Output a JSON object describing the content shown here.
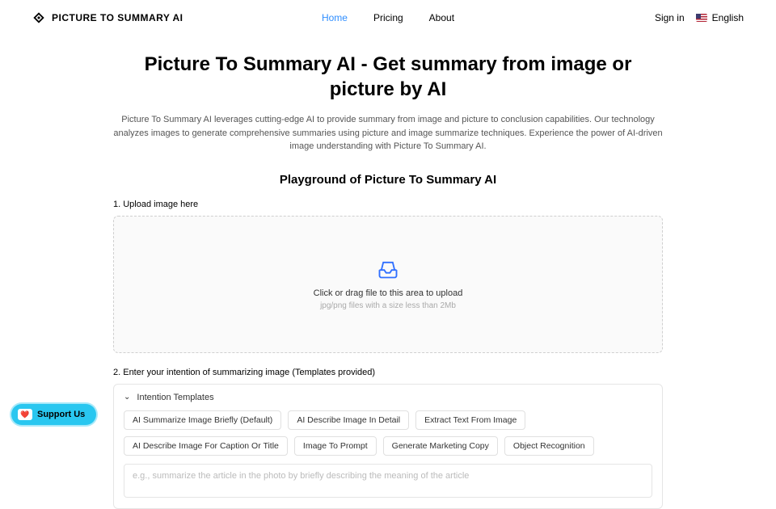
{
  "brand": "PICTURE TO SUMMARY AI",
  "nav": {
    "home": "Home",
    "pricing": "Pricing",
    "about": "About"
  },
  "header": {
    "signin": "Sign in",
    "lang": "English"
  },
  "hero": {
    "title": "Picture To Summary AI - Get summary from image or picture by AI",
    "desc": "Picture To Summary AI leverages cutting-edge AI to provide summary from image and picture to conclusion capabilities. Our technology analyzes images to generate comprehensive summaries using picture and image summarize techniques. Experience the power of AI-driven image understanding with Picture To Summary AI."
  },
  "playground": {
    "title": "Playground of Picture To Summary AI",
    "step1": "1. Upload image here",
    "upload_text": "Click or drag file to this area to upload",
    "upload_hint": "jpg/png files with a size less than 2Mb",
    "step2": "2. Enter your intention of summarizing image (Templates provided)",
    "templates_label": "Intention Templates",
    "chips": [
      "AI Summarize Image Briefly (Default)",
      "AI Describe Image In Detail",
      "Extract Text From Image",
      "AI Describe Image For Caption Or Title",
      "Image To Prompt",
      "Generate Marketing Copy",
      "Object Recognition"
    ],
    "placeholder": "e.g., summarize the article in the photo by briefly describing the meaning of the article"
  },
  "support": "Support Us"
}
